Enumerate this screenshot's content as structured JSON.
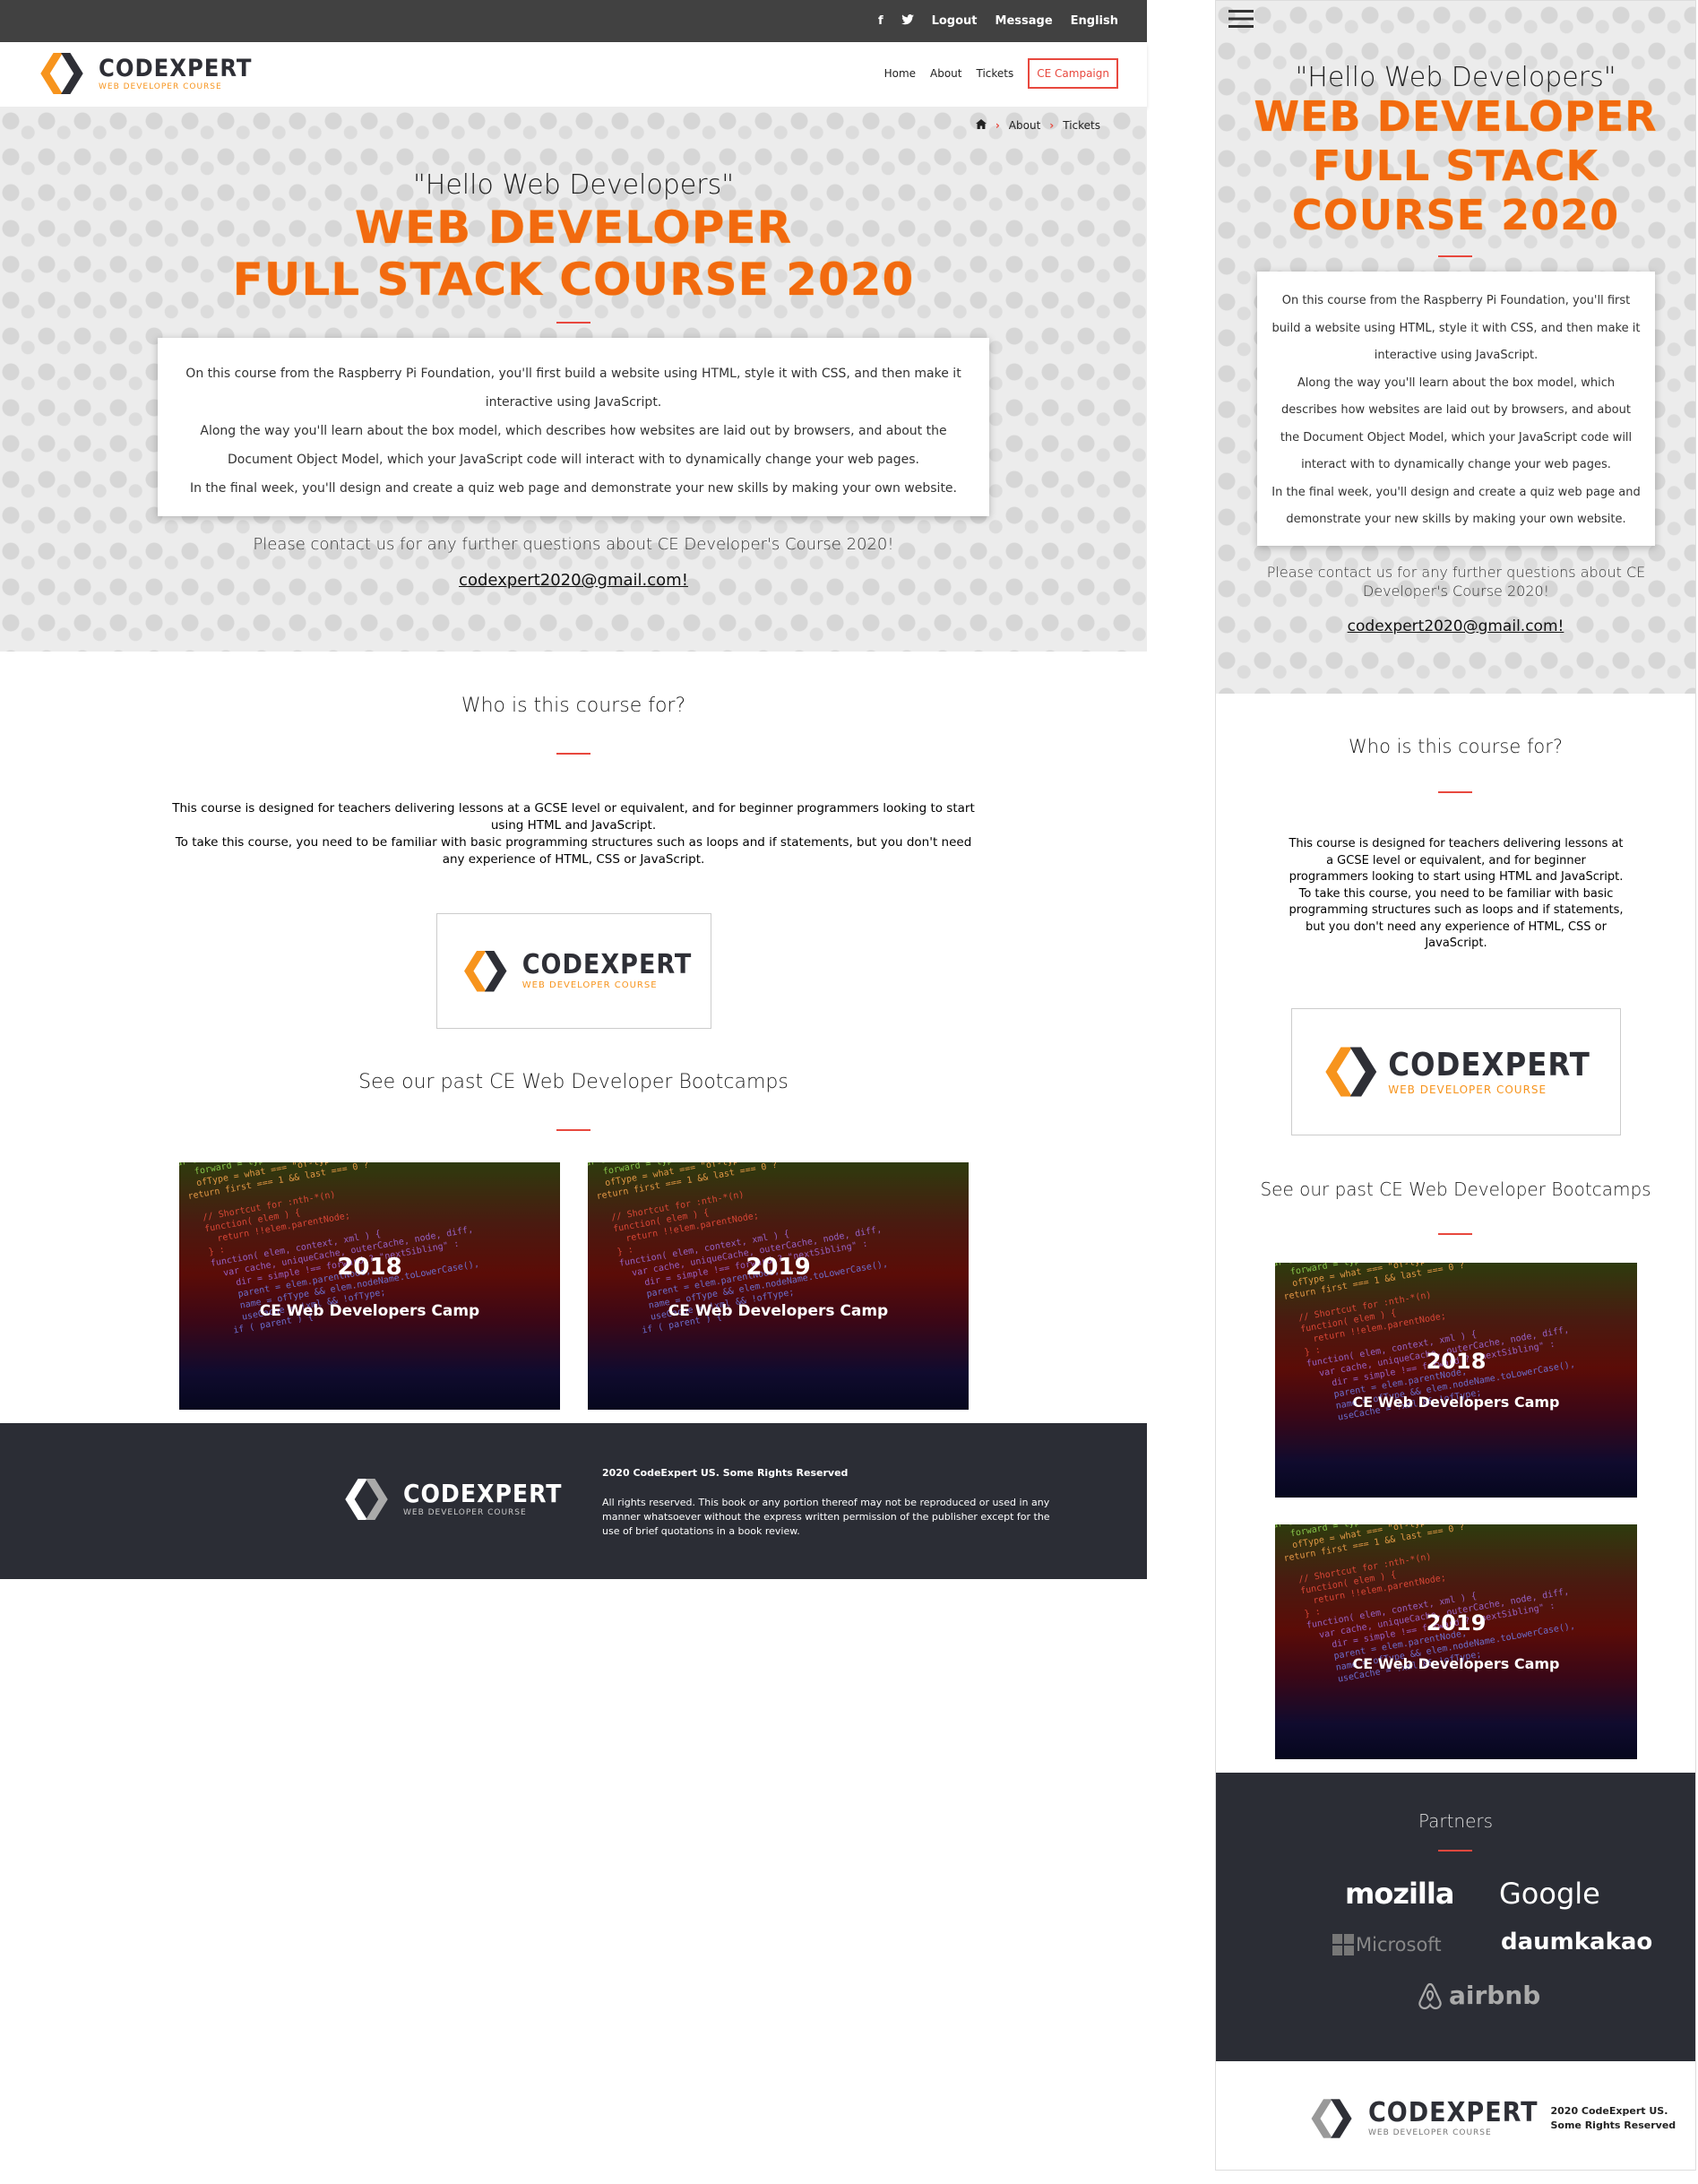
{
  "topbar": {
    "logout": "Logout",
    "message": "Message",
    "language": "English",
    "facebook": "f",
    "twitter": "t"
  },
  "logo": {
    "word": "CODEXPERT",
    "tagline": "WEB DEVELOPER COURSE"
  },
  "nav": {
    "home": "Home",
    "about": "About",
    "tickets": "Tickets",
    "campaign": "CE Campaign"
  },
  "breadcrumb": {
    "about": "About",
    "tickets": "Tickets",
    "sep": "›"
  },
  "hero": {
    "hello": "\"Hello Web Developers\"",
    "title1": "WEB DEVELOPER",
    "title2": "FULL STACK COURSE 2020",
    "mob_title2": "FULL STACK",
    "mob_title3": "COURSE 2020",
    "p1": "On this course from the Raspberry Pi Foundation, you'll first build a website using HTML, style it with CSS, and then make it interactive using JavaScript.",
    "p2": "Along the way you'll learn about the box model, which describes how websites are laid out by browsers, and about the Document Object Model, which your JavaScript code will interact with to dynamically change your web pages.",
    "p3": "In the final week, you'll design and create a quiz web page and demonstrate your new skills by making your own website.",
    "contact": "Please contact us for any further questions about CE Developer's Course 2020!",
    "email": "codexpert2020@gmail.com!"
  },
  "who": {
    "heading": "Who is this course for?",
    "p1": "This course is designed for teachers delivering lessons at a GCSE level or equivalent, and for beginner programmers looking to start using HTML and JavaScript.",
    "p2": "To take this course, you need to be familiar with basic programming structures such as loops and if statements, but you don't need any experience of HTML, CSS or JavaScript."
  },
  "past": {
    "heading": "See our past CE Web Developer Bootcamps",
    "camps": [
      {
        "year": "2018",
        "title": "CE Web Developers Camp"
      },
      {
        "year": "2019",
        "title": "CE Web Developers Camp"
      }
    ]
  },
  "footer": {
    "rights_title": "2020 CodeExpert US. Some Rights Reserved",
    "rights_body": "All rights reserved. This book or any portion thereof may not be reproduced or used in any manner whatsoever without the express written permission of the publisher except for the use of brief quotations in a book review.",
    "mob_rights1": "2020 CodeExpert US.",
    "mob_rights2": "Some Rights Reserved"
  },
  "partners": {
    "heading": "Partners",
    "names": [
      "mozilla",
      "Google",
      "Microsoft",
      "daumkakao",
      "airbnb"
    ]
  },
  "colors": {
    "accent": "#e8483e",
    "orange": "#f26a0f",
    "dark": "#2b2d35",
    "topbar": "#414141"
  }
}
